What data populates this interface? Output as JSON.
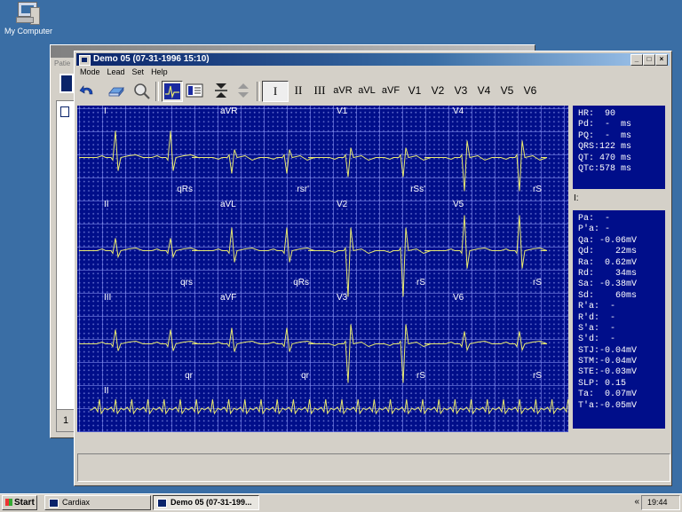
{
  "desktop": {
    "icon_label": "My Computer"
  },
  "bg_window": {
    "title": "Cardiax",
    "row_text": "Patie",
    "bottom_label": "1"
  },
  "window": {
    "title": "Demo 05 (07-31-1996 15:10)",
    "menu": [
      "Mode",
      "Lead",
      "Set",
      "Help"
    ],
    "toolbar_icons": [
      "undo-arrow-icon",
      "print-icon",
      "zoom-icon",
      "ecg-view-icon",
      "layout-icon",
      "move-down-icon",
      "move-up-icon"
    ],
    "lead_buttons": [
      "I",
      "II",
      "III",
      "aVR",
      "aVL",
      "aVF",
      "V1",
      "V2",
      "V3",
      "V4",
      "V5",
      "V6"
    ],
    "selected_lead": "I",
    "leads": [
      {
        "name": "I",
        "morph": "qRs"
      },
      {
        "name": "aVR",
        "morph": "rsr'"
      },
      {
        "name": "V1",
        "morph": "rSs'"
      },
      {
        "name": "V4",
        "morph": "rS"
      },
      {
        "name": "II",
        "morph": "qrs"
      },
      {
        "name": "aVL",
        "morph": "qRs"
      },
      {
        "name": "V2",
        "morph": "rS"
      },
      {
        "name": "V5",
        "morph": "rS"
      },
      {
        "name": "III",
        "morph": "qr"
      },
      {
        "name": "aVF",
        "morph": "qr"
      },
      {
        "name": "V3",
        "morph": "rS"
      },
      {
        "name": "V6",
        "morph": "rS"
      }
    ],
    "rhythm_lead": "II",
    "summary": [
      "HR:  90",
      "Pd:  -  ms",
      "PQ:  -  ms",
      "QRS:122 ms",
      "QT: 470 ms",
      "QTc:578 ms"
    ],
    "lead_label": "I:",
    "measurements": [
      "Pa:  -",
      "P'a: -",
      "Qa: -0.06mV",
      "Qd:    22ms",
      "Ra:  0.62mV",
      "Rd:    34ms",
      "Sa: -0.38mV",
      "Sd:    60ms",
      "R'a:  -",
      "R'd:  -",
      "S'a:  -",
      "S'd:  -",
      "STJ:-0.04mV",
      "STM:-0.04mV",
      "STE:-0.03mV",
      "SLP: 0.15",
      "Ta:  0.07mV",
      "T'a:-0.05mV"
    ],
    "colors": {
      "grid_bg": "#000e8a",
      "trace": "#e8e870",
      "gridline": "#8890ff"
    }
  },
  "taskbar": {
    "start": "Start",
    "tasks": [
      "Cardiax",
      "Demo 05 (07-31-199..."
    ],
    "clock": "19:44",
    "chevron": "«"
  }
}
